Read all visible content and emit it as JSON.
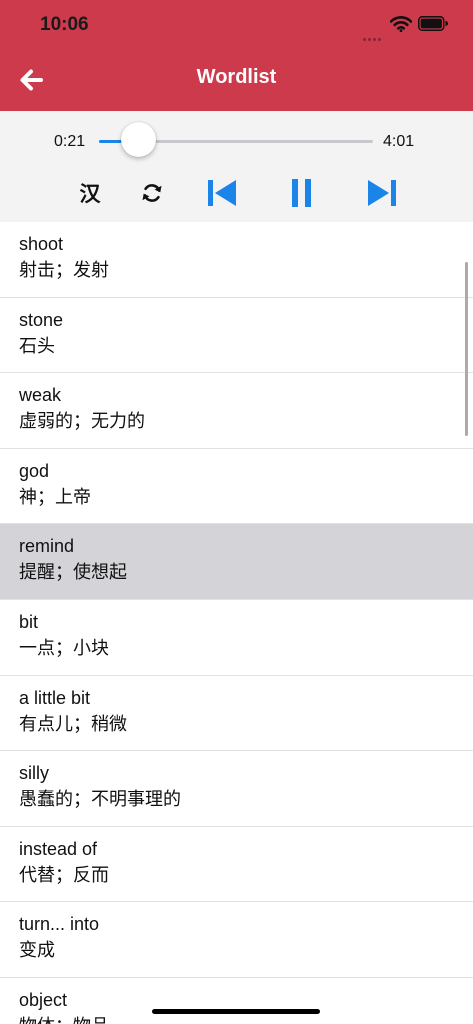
{
  "status": {
    "time": "10:06"
  },
  "nav": {
    "title": "Wordlist",
    "back_icon": "arrow-left-icon"
  },
  "player": {
    "elapsed": "0:21",
    "total": "4:01",
    "progress": 0.087,
    "language_toggle": "汉",
    "accent_color": "#1a84e8"
  },
  "theme": {
    "header_color": "#cc3a4c"
  },
  "words": [
    {
      "word": "shoot",
      "meaning": "射击；发射",
      "selected": false
    },
    {
      "word": "stone",
      "meaning": "石头",
      "selected": false
    },
    {
      "word": "weak",
      "meaning": "虚弱的；无力的",
      "selected": false
    },
    {
      "word": "god",
      "meaning": "神；上帝",
      "selected": false
    },
    {
      "word": "remind",
      "meaning": "提醒；使想起",
      "selected": true
    },
    {
      "word": "bit",
      "meaning": "一点；小块",
      "selected": false
    },
    {
      "word": "a little bit",
      "meaning": "有点儿；稍微",
      "selected": false
    },
    {
      "word": "silly",
      "meaning": "愚蠢的；不明事理的",
      "selected": false
    },
    {
      "word": "instead of",
      "meaning": "代替；反而",
      "selected": false
    },
    {
      "word": "turn... into",
      "meaning": "变成",
      "selected": false
    },
    {
      "word": "object",
      "meaning": "物体；物品",
      "selected": false
    }
  ]
}
